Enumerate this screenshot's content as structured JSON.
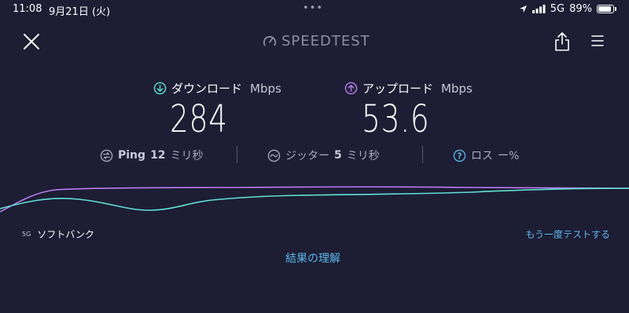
{
  "status_bar": {
    "time": "11:08",
    "date": "9月21日 (火)",
    "dots": "•••",
    "network": "5G",
    "battery_percent": "89%",
    "battery_level": 0.89
  },
  "header": {
    "logo_text": "SPEEDTEST",
    "close_icon": "close-icon",
    "share_icon": "share-icon",
    "menu_icon": "menu-icon"
  },
  "results": {
    "download": {
      "label": "ダウンロード",
      "unit": "Mbps",
      "value": "284",
      "color": "#5fe0d0"
    },
    "upload": {
      "label": "アップロード",
      "unit": "Mbps",
      "value": "53.6",
      "color": "#b97cf0"
    },
    "ping": {
      "label": "Ping",
      "value": "12",
      "unit": "ミリ秒"
    },
    "jitter": {
      "label": "ジッター",
      "value": "5",
      "unit": "ミリ秒"
    },
    "loss": {
      "label": "ロス",
      "value": "ー%"
    }
  },
  "footer": {
    "carrier_badge": "5G",
    "carrier_name": "ソフトバンク",
    "retest_label": "もう一度テストする",
    "understand_results_label": "結果の理解"
  },
  "colors": {
    "background": "#1d1d34",
    "link": "#5bb6e8",
    "download": "#5fe0d0",
    "upload": "#b97cf0"
  }
}
